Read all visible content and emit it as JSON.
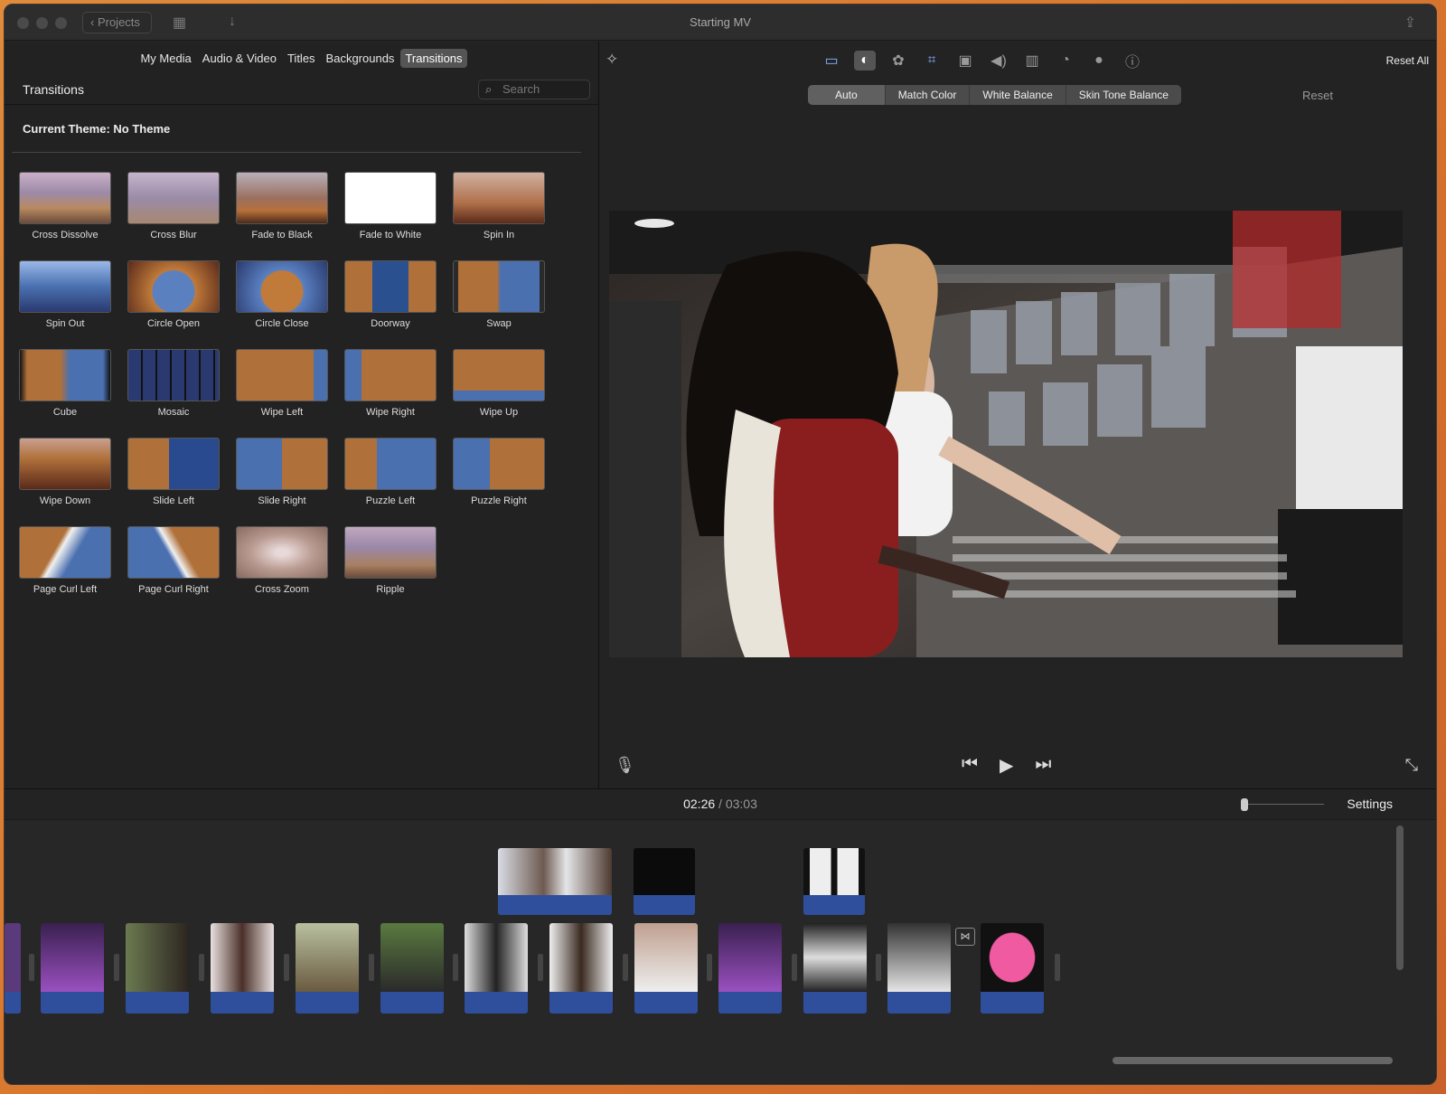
{
  "window": {
    "title": "Starting MV",
    "projects_label": "Projects"
  },
  "media_tabs": [
    {
      "label": "My Media",
      "active": false
    },
    {
      "label": "Audio & Video",
      "active": false
    },
    {
      "label": "Titles",
      "active": false
    },
    {
      "label": "Backgrounds",
      "active": false
    },
    {
      "label": "Transitions",
      "active": true
    }
  ],
  "browser": {
    "header": "Transitions",
    "search_placeholder": "Search",
    "theme": "Current Theme: No Theme",
    "transitions": [
      "Cross Dissolve",
      "Cross Blur",
      "Fade to Black",
      "Fade to White",
      "Spin In",
      "Spin Out",
      "Circle Open",
      "Circle Close",
      "Doorway",
      "Swap",
      "Cube",
      "Mosaic",
      "Wipe Left",
      "Wipe Right",
      "Wipe Up",
      "Wipe Down",
      "Slide Left",
      "Slide Right",
      "Puzzle Left",
      "Puzzle Right",
      "Page Curl Left",
      "Page Curl Right",
      "Cross Zoom",
      "Ripple"
    ]
  },
  "viewer": {
    "reset_all": "Reset All",
    "reset": "Reset",
    "color_buttons": [
      "Auto",
      "Match Color",
      "White Balance",
      "Skin Tone Balance"
    ],
    "tool_icons": [
      "crop-frame-icon",
      "color-balance-icon",
      "palette-icon",
      "crop-icon",
      "stabilization-icon",
      "volume-icon",
      "equalizer-icon",
      "speed-icon",
      "filter-icon",
      "info-icon"
    ]
  },
  "timeline": {
    "current_time": "02:26",
    "separator": "/",
    "total_time": "03:03",
    "settings": "Settings"
  },
  "colors": {
    "accent": "#8ab4ff",
    "audio": "#2f4f9c",
    "background": "#232323"
  }
}
